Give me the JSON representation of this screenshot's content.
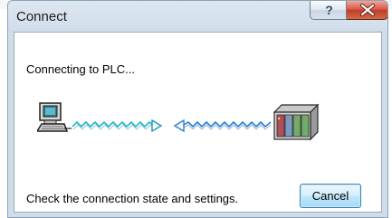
{
  "window": {
    "title": "Connect",
    "help_glyph": "?",
    "close_icon": "close-icon"
  },
  "dialog": {
    "status_text": "Connecting to PLC...",
    "hint_text": "Check the connection state and settings.",
    "cancel_label": "Cancel"
  },
  "graphic": {
    "icons": [
      "computer-icon",
      "plc-icon"
    ],
    "link_color": "#27b7c8",
    "return_color": "#2a7fd0"
  },
  "colors": {
    "title_bar": "#d3dfec",
    "close_button": "#c43c2b",
    "cancel_border": "#3c7fb1"
  }
}
